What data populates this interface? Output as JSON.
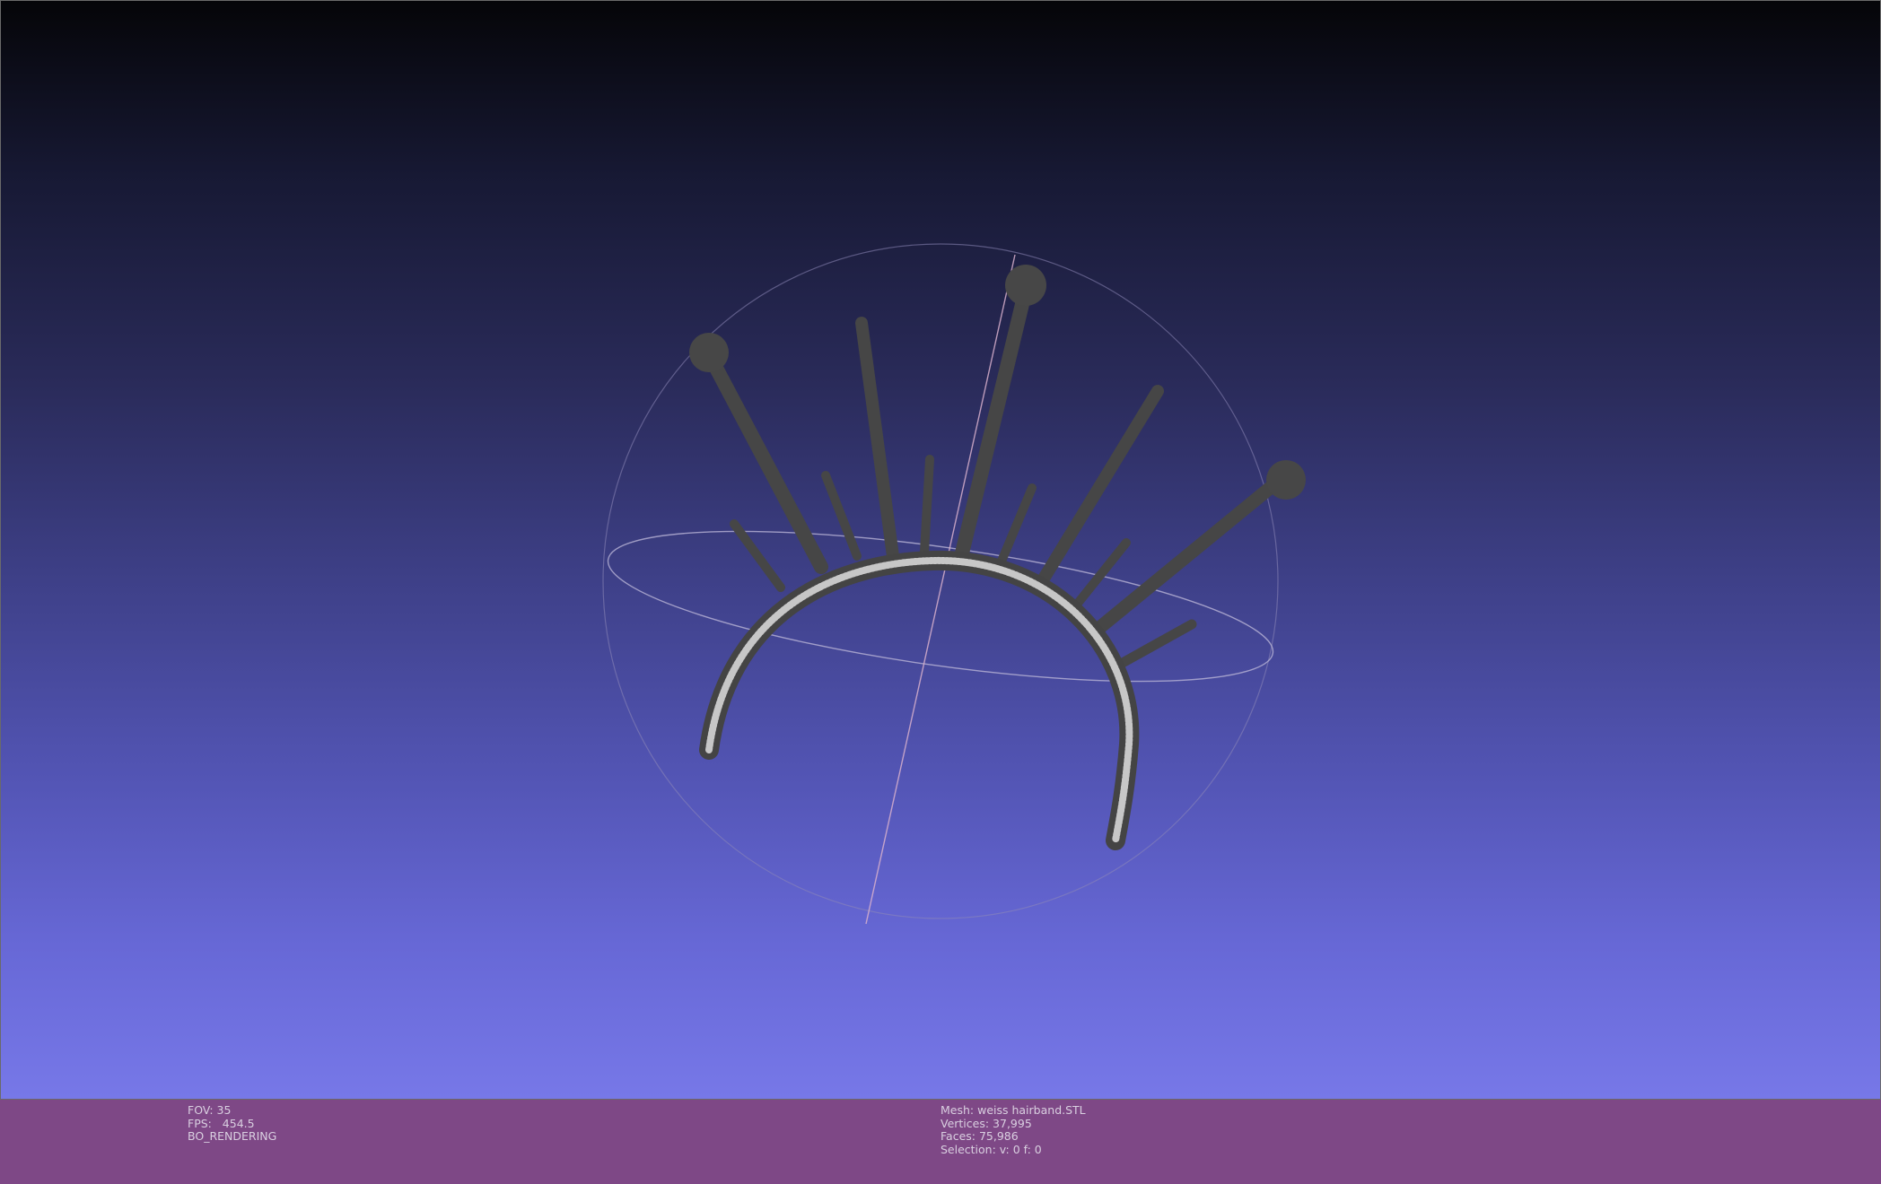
{
  "viewer": {
    "background": {
      "top": "#050508",
      "bottom": "#7778e8"
    },
    "mesh_color": "#454545",
    "mesh_edge_color": "#d8d8d8",
    "trackball_color": "#a9a4c4",
    "axis_color": "#d8b0cc"
  },
  "infobar": {
    "background": "#7e4886",
    "text_color": "#d9cfe0",
    "left": {
      "fov": "FOV: 35",
      "fps": "FPS:   454.5",
      "mode": "BO_RENDERING"
    },
    "right": {
      "mesh": "Mesh: weiss hairband.STL",
      "vertices": "Vertices: 37,995",
      "faces": "Faces: 75,986",
      "selection": "Selection: v: 0 f: 0"
    }
  }
}
